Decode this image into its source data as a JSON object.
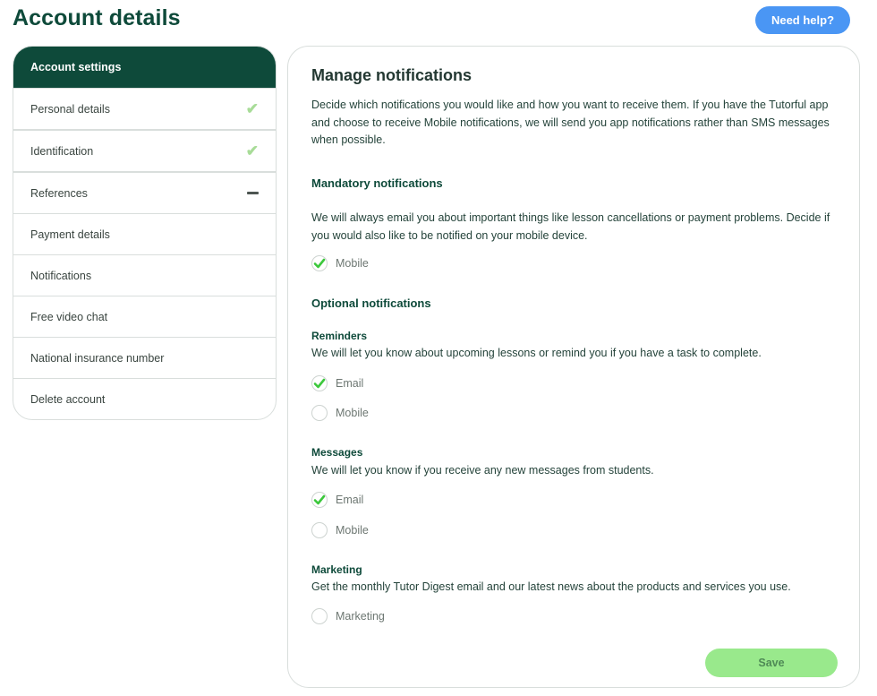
{
  "page": {
    "title": "Account details",
    "help_label": "Need help?"
  },
  "sidebar": {
    "header": "Account settings",
    "items": [
      {
        "label": "Personal details",
        "status": "complete"
      },
      {
        "label": "Identification",
        "status": "complete"
      },
      {
        "label": "References",
        "status": "pending"
      },
      {
        "label": "Payment details",
        "status": "none"
      },
      {
        "label": "Notifications",
        "status": "none"
      },
      {
        "label": "Free video chat",
        "status": "none"
      },
      {
        "label": "National insurance number",
        "status": "none"
      },
      {
        "label": "Delete account",
        "status": "none"
      }
    ]
  },
  "notifications": {
    "title": "Manage notifications",
    "intro": "Decide which notifications you would like and how you want to receive them. If you have the Tutorful app and choose to receive Mobile notifications, we will send you app notifications rather than SMS messages when possible.",
    "mandatory": {
      "title": "Mandatory notifications",
      "description": "We will always email you about important things like lesson cancellations or payment problems. Decide if you would also like to be notified on your mobile device.",
      "options": [
        {
          "label": "Mobile",
          "checked": true
        }
      ]
    },
    "optional_title": "Optional notifications",
    "reminders": {
      "title": "Reminders",
      "description": "We will let you know about upcoming lessons or remind you if you have a task to complete.",
      "options": [
        {
          "label": "Email",
          "checked": true
        },
        {
          "label": "Mobile",
          "checked": false
        }
      ]
    },
    "messages": {
      "title": "Messages",
      "description": "We will let you know if you receive any new messages from students.",
      "options": [
        {
          "label": "Email",
          "checked": true
        },
        {
          "label": "Mobile",
          "checked": false
        }
      ]
    },
    "marketing": {
      "title": "Marketing",
      "description": "Get the monthly Tutor Digest email and our latest news about the products and services you use.",
      "options": [
        {
          "label": "Marketing",
          "checked": false
        }
      ]
    },
    "save_label": "Save"
  },
  "colors": {
    "brand": "#0e4a3a",
    "help_button": "#4a96f4",
    "check": "#3cc83c",
    "save_button": "#99e98c"
  },
  "icons": {
    "complete": "checkmark-icon",
    "pending": "dash-icon",
    "checkbox_checked": "checkmark-icon"
  }
}
